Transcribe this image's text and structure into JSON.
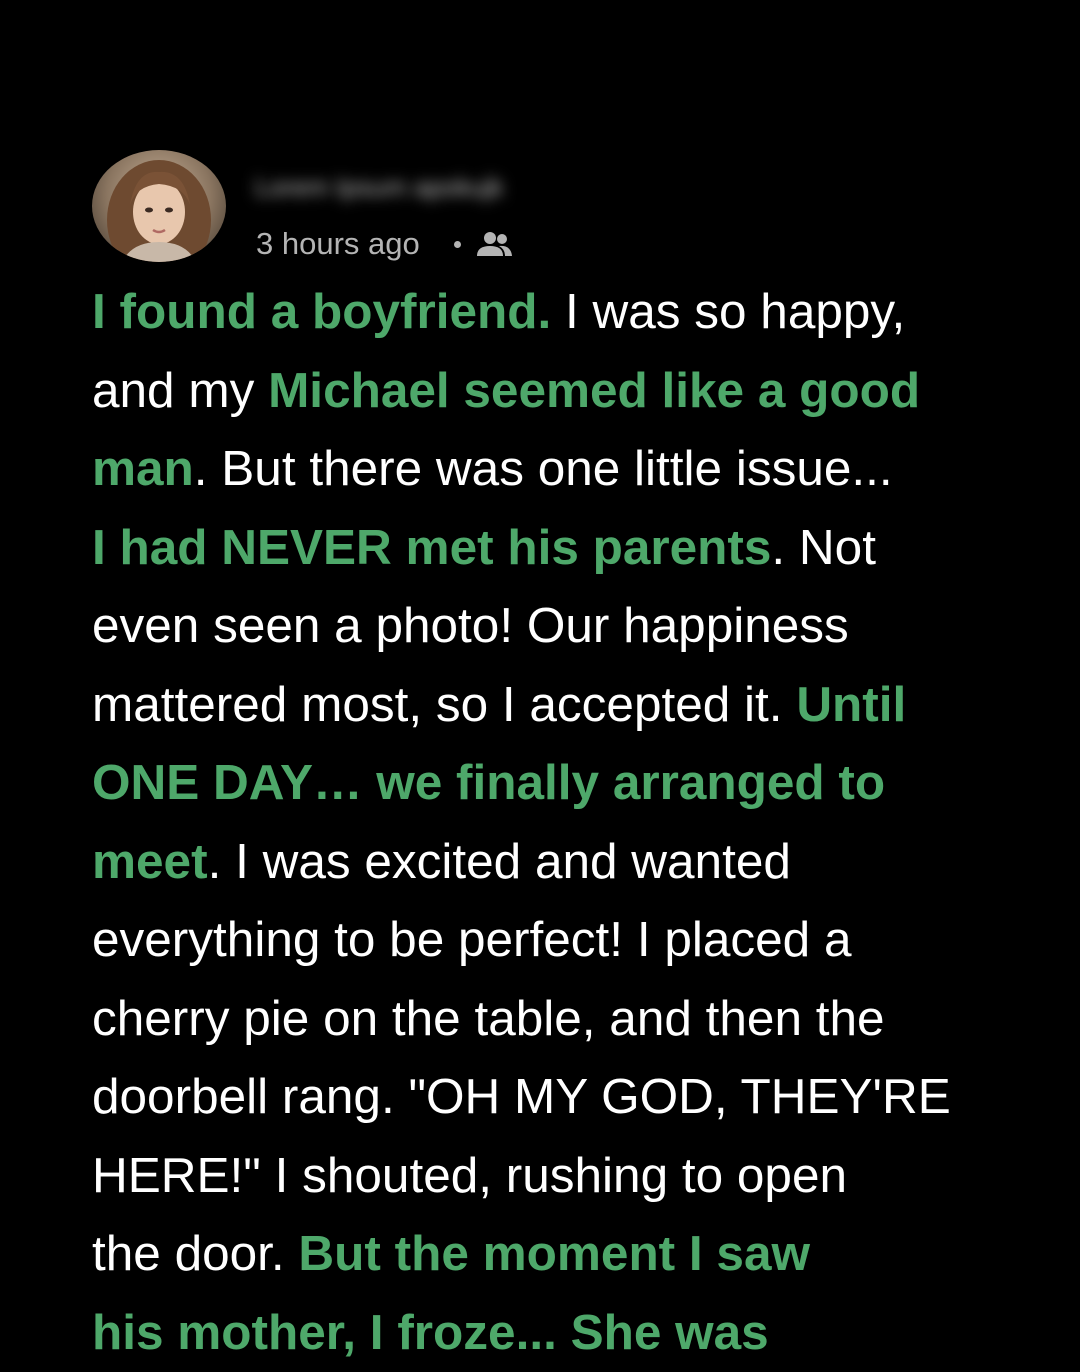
{
  "post": {
    "author_name": "Lorem Ipsum apokujk",
    "timestamp": "3 hours ago",
    "audience_icon": "friends-icon",
    "colors": {
      "background": "#000000",
      "text": "#ffffff",
      "highlight": "#4ea86a",
      "meta": "#b4b4b4"
    },
    "story": [
      {
        "text": "I found a boyfriend.",
        "highlight": true
      },
      {
        "text": " I was so happy,\nand my ",
        "highlight": false
      },
      {
        "text": "Michael seemed like a good\nman",
        "highlight": true
      },
      {
        "text": ". But there was one little issue...\n",
        "highlight": false
      },
      {
        "text": "I had NEVER met his parents",
        "highlight": true
      },
      {
        "text": ". Not\neven seen a photo! Our happiness\nmattered most, so I accepted it. ",
        "highlight": false
      },
      {
        "text": "Until\nONE DAY… we finally arranged to\nmeet",
        "highlight": true
      },
      {
        "text": ". I was excited and wanted\neverything to be perfect! I placed a\ncherry pie on the table, and then the\ndoorbell rang. \"OH MY GOD, THEY'RE\nHERE!\" I shouted, rushing to open\nthe door. ",
        "highlight": false
      },
      {
        "text": "But the moment I saw\nhis mother, I froze... She was",
        "highlight": true
      }
    ]
  }
}
